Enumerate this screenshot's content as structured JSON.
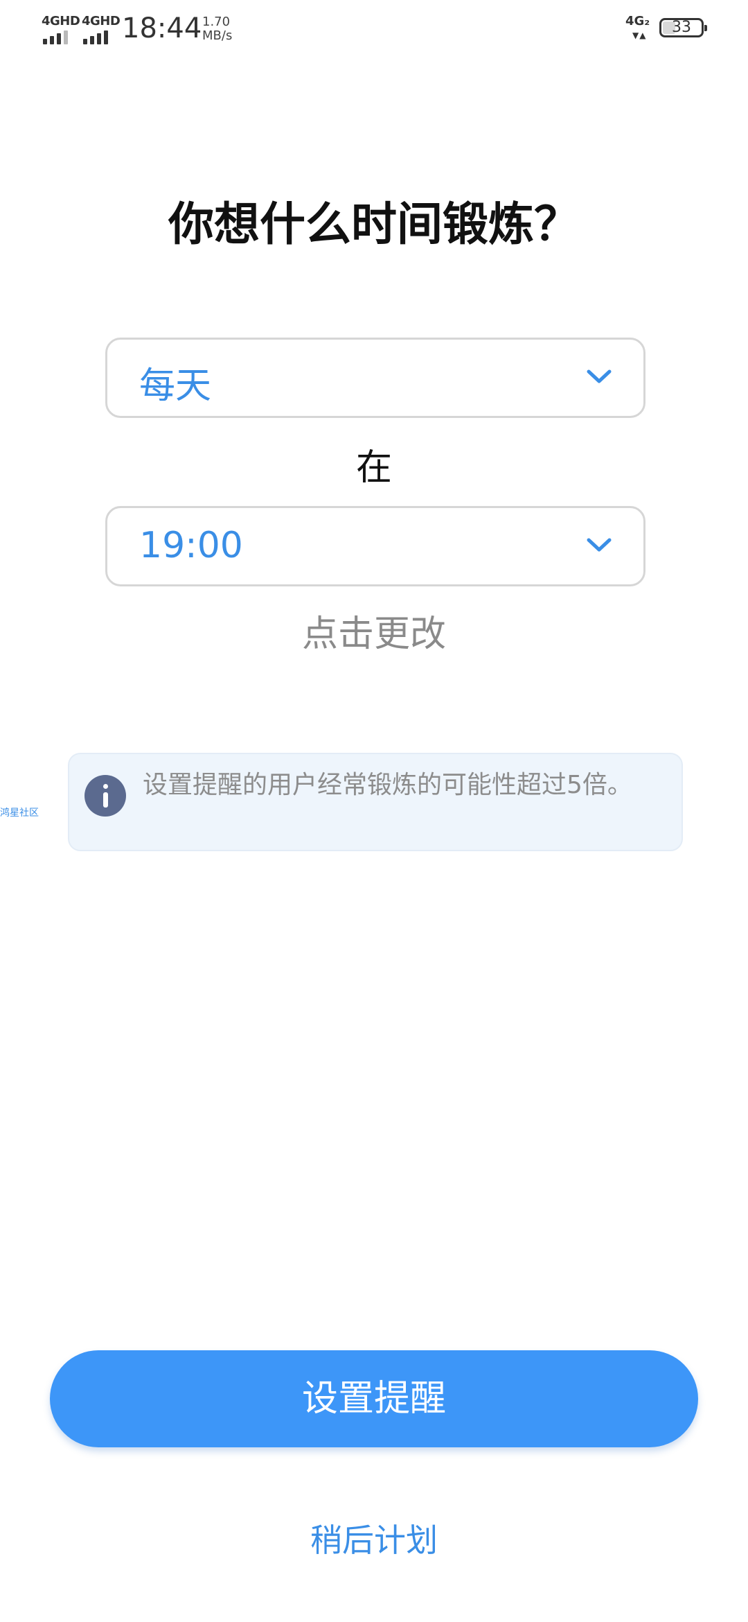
{
  "status_bar": {
    "network_1": "4GHD",
    "network_2": "4GHD",
    "time": "18:44",
    "speed_value": "1.70",
    "speed_unit": "MB/s",
    "network_right": "4G₂",
    "battery_level": "33"
  },
  "title": "你想什么时间锻炼？",
  "frequency_select": {
    "value": "每天"
  },
  "at_label": "在",
  "time_select": {
    "value": "19:00"
  },
  "change_hint": "点击更改",
  "side_watermark": "鸿星社区",
  "info": {
    "text": "设置提醒的用户经常锻炼的可能性超过5倍。"
  },
  "buttons": {
    "set_reminder": "设置提醒",
    "plan_later": "稍后计划"
  },
  "colors": {
    "accent": "#3a8ee6",
    "primary_button": "#3d96f8",
    "info_bg": "#eef5fc",
    "info_icon": "#5b6a8f"
  }
}
